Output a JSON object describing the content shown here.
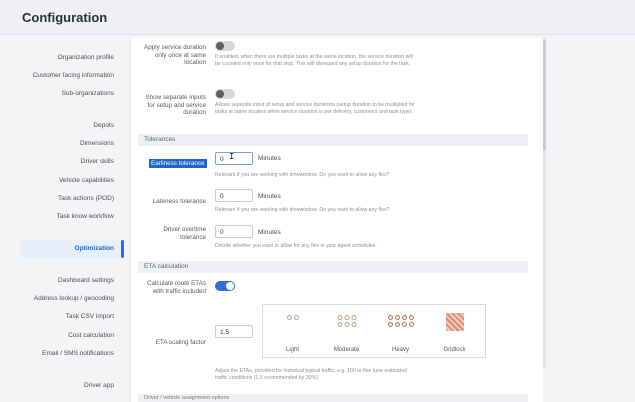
{
  "page": {
    "title": "Configuration"
  },
  "sidebar": {
    "items": [
      {
        "label": "Organization profile"
      },
      {
        "label": "Customer facing information"
      },
      {
        "label": "Sub-organizations"
      },
      {
        "label": "Depots"
      },
      {
        "label": "Dimensions"
      },
      {
        "label": "Driver skills"
      },
      {
        "label": "Vehicle capabilities"
      },
      {
        "label": "Task actions (POD)"
      },
      {
        "label": "Task know workflow"
      },
      {
        "label": "Optimization"
      },
      {
        "label": "Dashboard settings"
      },
      {
        "label": "Address lookup / geocoding"
      },
      {
        "label": "Task CSV import"
      },
      {
        "label": "Cost calculation"
      },
      {
        "label": "Email / SMS notifications"
      },
      {
        "label": "Driver app"
      }
    ],
    "active_index": 9
  },
  "settings": {
    "service_duration": {
      "label": "Apply service duration only once at same location",
      "enabled": false,
      "description": "If enabled, when there are multiple tasks at the same location, the service duration will be counted only once for that stop. This will disregard any setup duration for the task."
    },
    "separate_inputs": {
      "label": "Show separate inputs for setup and service duration",
      "enabled": false,
      "description": "Allows separate input of setup and service durations (setup duration to be multiplied for tasks at same location while service duration is per delivery, customers and task type)."
    }
  },
  "tolerances": {
    "section_title": "Tolerances",
    "earliness": {
      "label": "Earliness tolerance",
      "value": "0",
      "unit": "Minutes",
      "description": "Relevant if you are working with timewindow. Do you want to allow any flex?"
    },
    "lateness": {
      "label": "Lateness tolerance",
      "value": "0",
      "unit": "Minutes",
      "description": "Relevant if you are working with timewindow. Do you want to allow any flex?"
    },
    "overtime": {
      "label": "Driver overtime tolerance",
      "value": "0",
      "unit": "Minutes",
      "description": "Decide whether you want to allow for any flex in your agent schedules."
    }
  },
  "eta": {
    "section_title": "ETA calculation",
    "route_etas": {
      "label": "Calculate route ETAs with traffic included",
      "enabled": true
    },
    "scaling": {
      "label": "ETA scaling factor",
      "value": "1.5",
      "options": [
        "Light",
        "Moderate",
        "Heavy",
        "Gridlock"
      ],
      "description": "Adjust the ETAs, provided for historical typical traffic, e.g. 100 to fine tune estimated traffic conditions (1.5 recommended by 30%)."
    }
  },
  "next_section": {
    "title": "Driver / vehicle assignment options"
  },
  "colors": {
    "accent": "#2f6fd6",
    "highlight": "#1f64c9"
  }
}
